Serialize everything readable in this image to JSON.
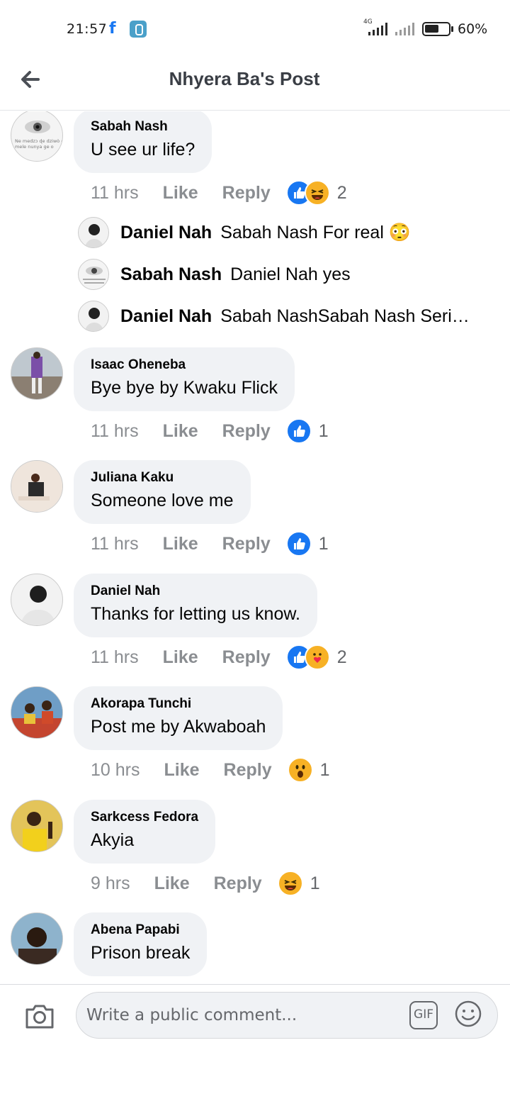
{
  "status_bar": {
    "time": "21:57",
    "fb_icon": "f",
    "network": "4G",
    "battery_text": "60%",
    "battery_level": 0.6
  },
  "header": {
    "title": "Nhyera Ba's Post",
    "back_icon": "arrow-left-icon"
  },
  "colors": {
    "like_blue": "#1877f2",
    "bubble_bg": "#f0f2f5",
    "meta_grey": "#8a8d91",
    "react_yellow": "#f7b125"
  },
  "actions": {
    "like": "Like",
    "reply": "Reply"
  },
  "comments": [
    {
      "author": "Sabah Nash",
      "text": "U see ur life?",
      "time": "11 hrs",
      "reactions": [
        "like",
        "haha"
      ],
      "reaction_count": "2"
    },
    {
      "author": "Isaac Oheneba",
      "text": "Bye bye by Kwaku Flick",
      "time": "11 hrs",
      "reactions": [
        "like"
      ],
      "reaction_count": "1"
    },
    {
      "author": "Juliana Kaku",
      "text": "Someone love me",
      "time": "11 hrs",
      "reactions": [
        "like"
      ],
      "reaction_count": "1"
    },
    {
      "author": "Daniel Nah",
      "text": "Thanks for letting us know.",
      "time": "11 hrs",
      "reactions": [
        "like",
        "care"
      ],
      "reaction_count": "2"
    },
    {
      "author": "Akorapa Tunchi",
      "text": "Post me by Akwaboah",
      "time": "10 hrs",
      "reactions": [
        "wow"
      ],
      "reaction_count": "1"
    },
    {
      "author": "Sarkcess Fedora",
      "text": "Akyia",
      "time": "9 hrs",
      "reactions": [
        "haha"
      ],
      "reaction_count": "1"
    },
    {
      "author": "Abena Papabi",
      "text": "Prison break"
    }
  ],
  "replies": [
    {
      "author": "Daniel Nah",
      "text": "Sabah Nash For real 😳"
    },
    {
      "author": "Sabah Nash",
      "text": "Daniel Nah yes"
    },
    {
      "author": "Daniel Nah",
      "text": "Sabah NashSabah Nash Seri…"
    }
  ],
  "avatar_texts": {
    "sabah_line1": "Ne medzɔ ɖe dziwò o",
    "sabah_line2": "mele nunya ge o"
  },
  "composer": {
    "placeholder": "Write a public comment...",
    "gif_label": "GIF",
    "camera_icon": "camera-icon",
    "emoji_icon": "emoji-icon"
  }
}
